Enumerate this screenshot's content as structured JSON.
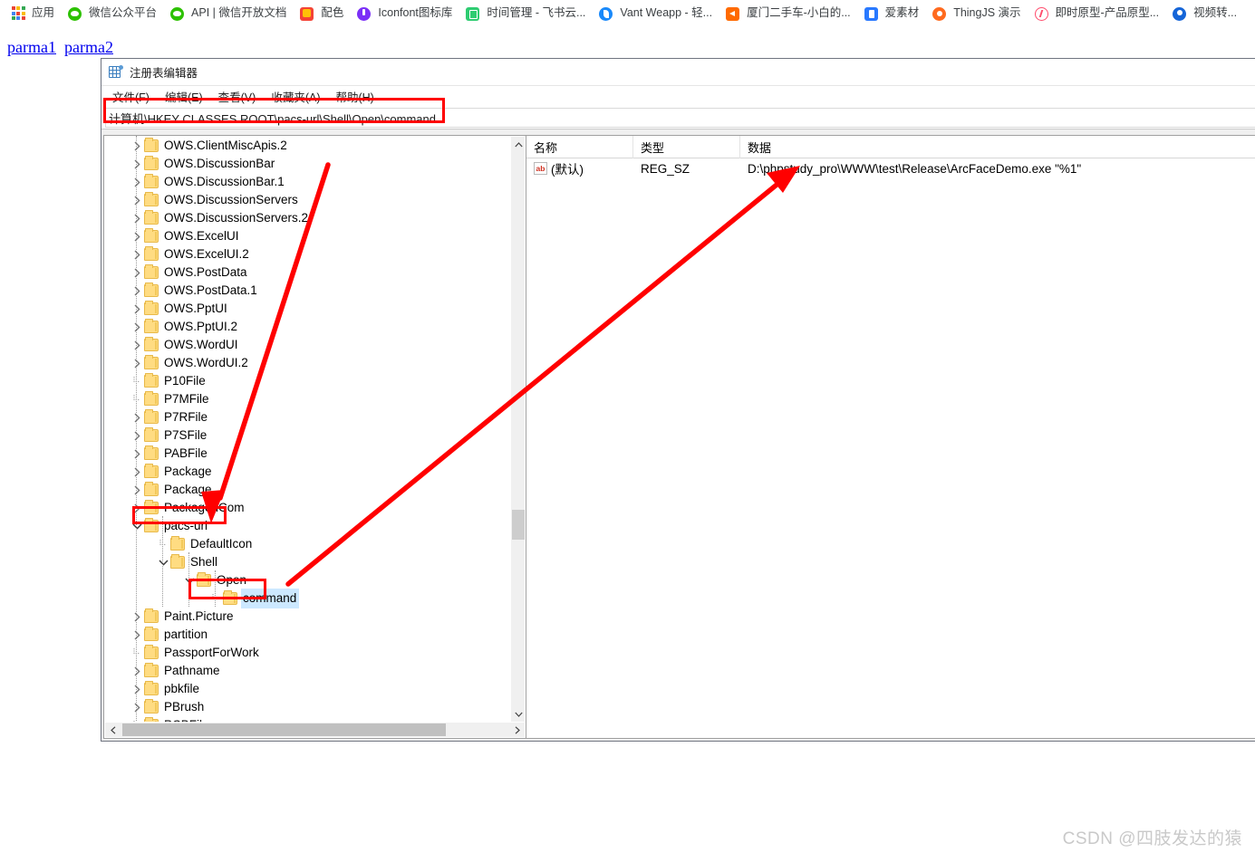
{
  "browser": {
    "bookmarks": [
      {
        "label": "应用",
        "icon": "apps-grid-icon"
      },
      {
        "label": "微信公众平台",
        "icon": "wechat-icon"
      },
      {
        "label": "API | 微信开放文档",
        "icon": "wechat-icon"
      },
      {
        "label": "配色",
        "icon": "palette-icon"
      },
      {
        "label": "Iconfont图标库",
        "icon": "iconfont-icon"
      },
      {
        "label": "时间管理 - 飞书云...",
        "icon": "feishu-doc-icon"
      },
      {
        "label": "Vant Weapp - 轻...",
        "icon": "vant-icon"
      },
      {
        "label": "厦门二手车-小白的...",
        "icon": "xmcar-icon"
      },
      {
        "label": "爱素材",
        "icon": "aisucai-icon"
      },
      {
        "label": "ThingJS 演示",
        "icon": "thingjs-icon"
      },
      {
        "label": "即时原型-产品原型...",
        "icon": "jishi-icon"
      },
      {
        "label": "视频转...",
        "icon": "video-icon"
      }
    ]
  },
  "page": {
    "links": [
      {
        "label": "parma1"
      },
      {
        "label": "parma2"
      }
    ]
  },
  "regedit": {
    "title": "注册表编辑器",
    "menus": [
      {
        "label": "文件(F)"
      },
      {
        "label": "编辑(E)"
      },
      {
        "label": "查看(V)"
      },
      {
        "label": "收藏夹(A)"
      },
      {
        "label": "帮助(H)"
      }
    ],
    "address": "计算机\\HKEY CLASSES ROOT\\pacs-url\\Shell\\Open\\command",
    "tree": [
      {
        "label": "OWS.ClientMiscApis.2",
        "depth": 1,
        "expander": "collapsed",
        "selected": false
      },
      {
        "label": "OWS.DiscussionBar",
        "depth": 1,
        "expander": "collapsed",
        "selected": false
      },
      {
        "label": "OWS.DiscussionBar.1",
        "depth": 1,
        "expander": "collapsed",
        "selected": false
      },
      {
        "label": "OWS.DiscussionServers",
        "depth": 1,
        "expander": "collapsed",
        "selected": false
      },
      {
        "label": "OWS.DiscussionServers.2",
        "depth": 1,
        "expander": "collapsed",
        "selected": false
      },
      {
        "label": "OWS.ExcelUI",
        "depth": 1,
        "expander": "collapsed",
        "selected": false
      },
      {
        "label": "OWS.ExcelUI.2",
        "depth": 1,
        "expander": "collapsed",
        "selected": false
      },
      {
        "label": "OWS.PostData",
        "depth": 1,
        "expander": "collapsed",
        "selected": false
      },
      {
        "label": "OWS.PostData.1",
        "depth": 1,
        "expander": "collapsed",
        "selected": false
      },
      {
        "label": "OWS.PptUI",
        "depth": 1,
        "expander": "collapsed",
        "selected": false
      },
      {
        "label": "OWS.PptUI.2",
        "depth": 1,
        "expander": "collapsed",
        "selected": false
      },
      {
        "label": "OWS.WordUI",
        "depth": 1,
        "expander": "collapsed",
        "selected": false
      },
      {
        "label": "OWS.WordUI.2",
        "depth": 1,
        "expander": "collapsed",
        "selected": false
      },
      {
        "label": "P10File",
        "depth": 1,
        "expander": "none",
        "selected": false
      },
      {
        "label": "P7MFile",
        "depth": 1,
        "expander": "none",
        "selected": false
      },
      {
        "label": "P7RFile",
        "depth": 1,
        "expander": "collapsed",
        "selected": false
      },
      {
        "label": "P7SFile",
        "depth": 1,
        "expander": "collapsed",
        "selected": false
      },
      {
        "label": "PABFile",
        "depth": 1,
        "expander": "collapsed",
        "selected": false
      },
      {
        "label": "Package",
        "depth": 1,
        "expander": "collapsed",
        "selected": false
      },
      {
        "label": "Package",
        "depth": 1,
        "expander": "collapsed",
        "selected": false
      },
      {
        "label": "PackagedCom",
        "depth": 1,
        "expander": "collapsed",
        "selected": false
      },
      {
        "label": "pacs-url",
        "depth": 1,
        "expander": "expanded",
        "selected": false
      },
      {
        "label": "DefaultIcon",
        "depth": 2,
        "expander": "none",
        "selected": false
      },
      {
        "label": "Shell",
        "depth": 2,
        "expander": "expanded",
        "selected": false
      },
      {
        "label": "Open",
        "depth": 3,
        "expander": "expanded",
        "selected": false
      },
      {
        "label": "command",
        "depth": 4,
        "expander": "none",
        "selected": true
      },
      {
        "label": "Paint.Picture",
        "depth": 1,
        "expander": "collapsed",
        "selected": false
      },
      {
        "label": "partition",
        "depth": 1,
        "expander": "collapsed",
        "selected": false
      },
      {
        "label": "PassportForWork",
        "depth": 1,
        "expander": "none",
        "selected": false
      },
      {
        "label": "Pathname",
        "depth": 1,
        "expander": "collapsed",
        "selected": false
      },
      {
        "label": "pbkfile",
        "depth": 1,
        "expander": "collapsed",
        "selected": false
      },
      {
        "label": "PBrush",
        "depth": 1,
        "expander": "collapsed",
        "selected": false
      },
      {
        "label": "PCBFile",
        "depth": 1,
        "expander": "none",
        "selected": false
      }
    ],
    "values": {
      "columns": [
        "名称",
        "类型",
        "数据"
      ],
      "rows": [
        {
          "icon": "ab-string-icon",
          "name": "(默认)",
          "type": "REG_SZ",
          "data": "D:\\phpstudy_pro\\WWW\\test\\Release\\ArcFaceDemo.exe \"%1\""
        }
      ]
    }
  },
  "annotations": {
    "highlight_color": "#FF0000",
    "boxes": [
      {
        "target": "address-bar"
      },
      {
        "target": "pacs-url-node"
      },
      {
        "target": "command-node"
      }
    ],
    "arrows": [
      {
        "from": "tree-upper-right",
        "to": "pacs-url-node"
      },
      {
        "from": "command-node",
        "to": "value-data-cell"
      }
    ]
  },
  "watermark": {
    "text": "CSDN @四肢发达的猿"
  }
}
